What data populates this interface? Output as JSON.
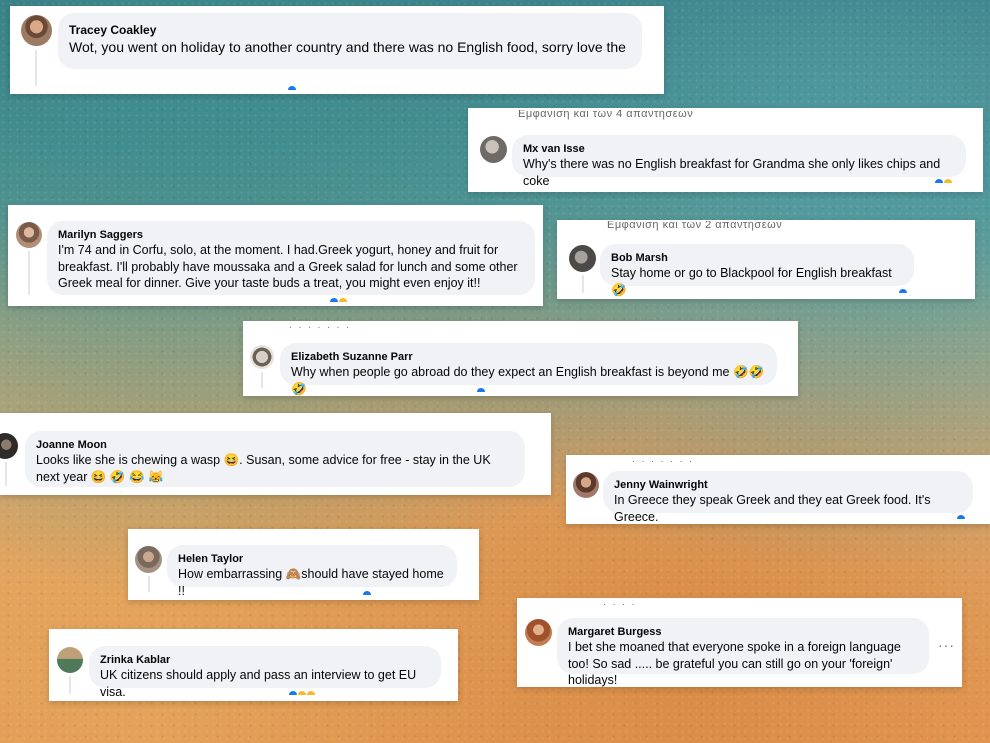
{
  "colors": {
    "bubble": "#f0f2f5",
    "reaction_like": "#1877f2",
    "reaction_haha": "#f7b928"
  },
  "comments": [
    {
      "id": "tracey",
      "name": "Tracey Coakley",
      "text": "Wot, you went on holiday to another country and there was no English food, sorry love the",
      "avatar_icon": "profile-photo-icon"
    },
    {
      "id": "mx",
      "header": "Εμφάνιση και των 4 απαντήσεων",
      "name": "Mx van Isse",
      "text": "Why's there was no English breakfast for Grandma she only likes chips and coke",
      "avatar_icon": "profile-photo-icon"
    },
    {
      "id": "marilyn",
      "name": "Marilyn Saggers",
      "text": "I'm 74 and in Corfu, solo, at the moment. I had.Greek yogurt, honey and fruit for breakfast. I'll probably have moussaka and a Greek salad for lunch and some other Greek meal for dinner. Give your taste buds a treat, you might even enjoy it!!",
      "avatar_icon": "profile-photo-icon"
    },
    {
      "id": "bob",
      "header": "Εμφάνιση και των 2 απαντήσεων",
      "name": "Bob Marsh",
      "text": "Stay home or go to Blackpool for English breakfast 🤣",
      "avatar_icon": "profile-photo-icon"
    },
    {
      "id": "elizabeth",
      "name": "Elizabeth Suzanne Parr",
      "text": "Why when people go abroad do they expect an English breakfast is beyond me 🤣🤣🤣",
      "avatar_icon": "profile-photo-icon"
    },
    {
      "id": "joanne",
      "name": "Joanne Moon",
      "text": "Looks like she is chewing a wasp 😆. Susan, some advice for free - stay in the UK next year 😆 🤣 😂 😹",
      "avatar_icon": "profile-photo-icon"
    },
    {
      "id": "jenny",
      "name": "Jenny Wainwright",
      "text": "In Greece they speak Greek and they eat Greek food. It's Greece.",
      "avatar_icon": "profile-photo-icon"
    },
    {
      "id": "helen",
      "name": "Helen Taylor",
      "text": "How embarrassing 🙈should have stayed home !!",
      "avatar_icon": "profile-photo-icon"
    },
    {
      "id": "margaret",
      "name": "Margaret Burgess",
      "text": "I bet she moaned that everyone spoke in a foreign language too! So sad ..... be grateful you can still go on your 'foreign' holidays!",
      "more_label": "···",
      "avatar_icon": "profile-photo-icon"
    },
    {
      "id": "zrinka",
      "name": "Zrinka Kablar",
      "text": "UK citizens should apply and pass an interview to get EU visa.",
      "avatar_icon": "profile-photo-icon"
    }
  ]
}
